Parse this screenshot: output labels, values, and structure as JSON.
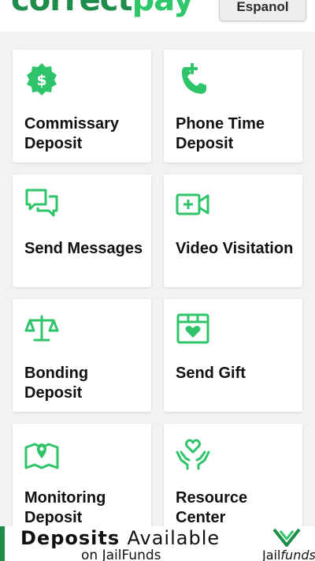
{
  "header": {
    "logo_part1": "correct",
    "logo_part2": "pay",
    "language_button": "Espanol"
  },
  "tiles": [
    {
      "label": "Commissary Deposit",
      "icon": "dollar-badge-icon"
    },
    {
      "label": "Phone Time Deposit",
      "icon": "phone-plus-icon"
    },
    {
      "label": "Send Messages",
      "icon": "chat-bubbles-icon"
    },
    {
      "label": "Video Visitation",
      "icon": "video-plus-icon"
    },
    {
      "label": "Bonding Deposit",
      "icon": "scales-icon"
    },
    {
      "label": "Send Gift",
      "icon": "gift-box-icon"
    },
    {
      "label": "Monitoring Deposit",
      "icon": "map-pin-icon"
    },
    {
      "label": "Resource Center",
      "icon": "hands-heart-icon"
    }
  ],
  "banner": {
    "headline_bold": "Deposits",
    "headline_rest": "Available",
    "subline": "on JailFunds",
    "brand_part1": "Jail",
    "brand_part2": "funds"
  },
  "colors": {
    "brand_green": "#30c76b",
    "dark_green": "#1e8c4a",
    "icon_green": "#2fc46a"
  }
}
